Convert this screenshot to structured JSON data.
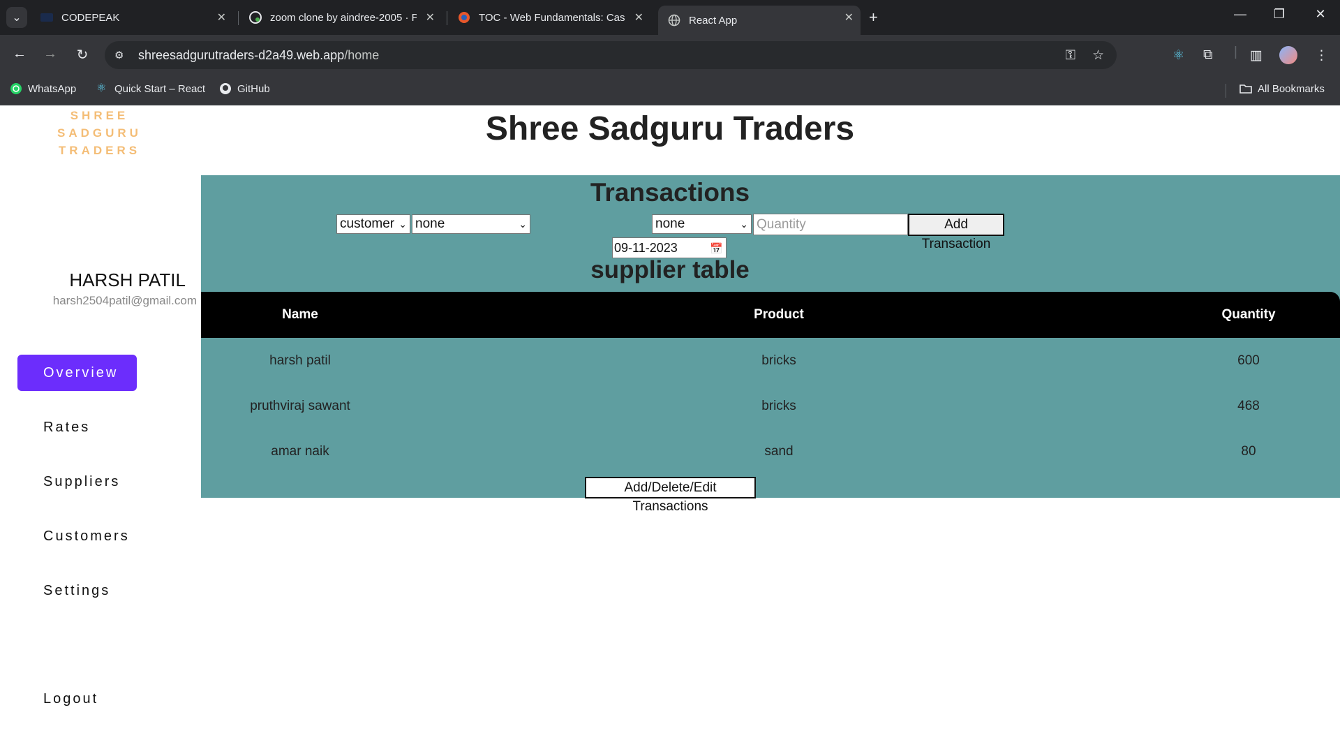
{
  "browser": {
    "tabs": [
      {
        "title": "CODEPEAK",
        "active": false
      },
      {
        "title": "zoom clone by aindree-2005 · P",
        "active": false
      },
      {
        "title": "TOC - Web Fundamentals: Casc",
        "active": false
      },
      {
        "title": "React App",
        "active": true
      }
    ],
    "url_host": "shreesadgurutraders-d2a49.web.app",
    "url_path": "/home",
    "bookmarks": [
      "WhatsApp",
      "Quick Start – React",
      "GitHub"
    ],
    "all_bookmarks": "All Bookmarks"
  },
  "sidebar": {
    "logo_lines": [
      "SHREE",
      "SADGURU",
      "TRADERS"
    ],
    "user_name": "HARSH PATIL",
    "user_email": "harsh2504patil@gmail.com",
    "nav": [
      "Overview",
      "Rates",
      "Suppliers",
      "Customers",
      "Settings"
    ],
    "active_nav": "Overview",
    "logout": "Logout"
  },
  "main": {
    "site_title": "Shree Sadguru Traders",
    "section_title": "Transactions",
    "form": {
      "type_select": "customer",
      "party_select": "none",
      "product_select": "none",
      "quantity_placeholder": "Quantity",
      "add_button": "Add Transaction",
      "date": "09-11-2023"
    },
    "table_title": "supplier table",
    "table": {
      "headers": [
        "Name",
        "Product",
        "Quantity"
      ],
      "rows": [
        [
          "harsh patil",
          "bricks",
          "600"
        ],
        [
          "pruthviraj sawant",
          "bricks",
          "468"
        ],
        [
          "amar naik",
          "sand",
          "80"
        ]
      ]
    },
    "edit_button": "Add/Delete/Edit Transactions"
  }
}
